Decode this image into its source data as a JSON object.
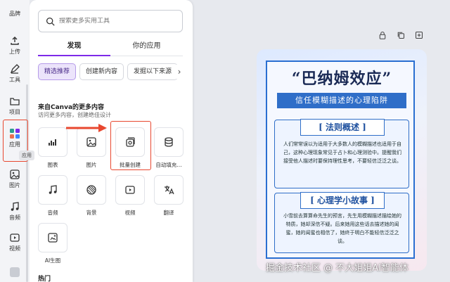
{
  "rail": {
    "items": [
      {
        "label": "品牌",
        "icon": "brand-icon"
      },
      {
        "label": "上传",
        "icon": "upload-icon"
      },
      {
        "label": "工具",
        "icon": "pen-tool-icon"
      },
      {
        "label": "项目",
        "icon": "folder-icon"
      },
      {
        "label": "应用",
        "icon": "apps-grid-icon"
      },
      {
        "label": "图片",
        "icon": "image-icon"
      },
      {
        "label": "音频",
        "icon": "music-note-icon"
      },
      {
        "label": "视频",
        "icon": "play-icon"
      }
    ],
    "tooltip": "应用"
  },
  "panel": {
    "search_placeholder": "搜索更多实用工具",
    "tabs": [
      {
        "label": "发现"
      },
      {
        "label": "你的应用"
      }
    ],
    "chips": [
      {
        "label": "精选推荐"
      },
      {
        "label": "创建新内容"
      },
      {
        "label": "发掘以下来源"
      }
    ],
    "section_title": "来自Canva的更多内容",
    "section_subtitle": "访问更多内容，创建绝佳设计",
    "tools": [
      {
        "label": "图表",
        "icon": "bar-chart-icon"
      },
      {
        "label": "图片",
        "icon": "image-icon"
      },
      {
        "label": "批量创建",
        "icon": "bulk-create-icon"
      },
      {
        "label": "自动填充...",
        "icon": "database-icon"
      },
      {
        "label": "音频",
        "icon": "music-note-icon"
      },
      {
        "label": "背景",
        "icon": "texture-icon"
      },
      {
        "label": "视频",
        "icon": "play-icon"
      },
      {
        "label": "翻译",
        "icon": "translate-icon"
      },
      {
        "label": "AI生图",
        "icon": "ai-image-icon"
      }
    ],
    "hot_title": "热门"
  },
  "poster": {
    "title": "“巴纳姆效应”",
    "banner": "信任模糊描述的心理陷阱",
    "section1_title": "[ 法则概述 ]",
    "section1_text": "人们常常误以为适用于大多数人的模糊描述也适用于自己，这种心理现象常见于占卜和心理测验中。提醒我们接受他人描述时要保持理性思考，不要轻信泛泛之谈。",
    "section2_title": "[ 心理学小故事 ]",
    "section2_text": "小雪前去算算命先生的预言，先生用模糊描述描绘她的特质，她却深信不疑。后来她用这些话去描述她的闺蜜，她的闺蜜也相信了，她终于明白不能轻信泛泛之谈。"
  },
  "watermark": "掘金技术社区 @ 不大姐姐AI智能体",
  "colors": {
    "accent": "#7d2ae8",
    "annotation_red": "#e8472f",
    "poster_blue": "#2f6ec8"
  }
}
